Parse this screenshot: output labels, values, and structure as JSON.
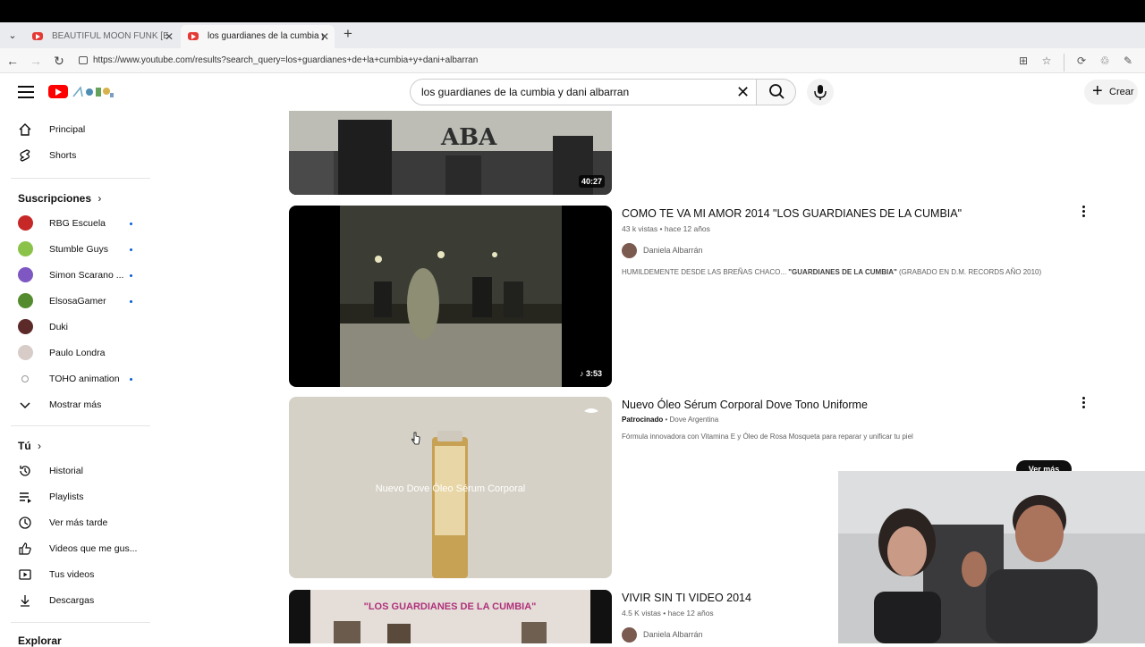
{
  "browser": {
    "tabs": [
      {
        "label": "BEAUTIFUL MOON FUNK [EXTENDED]",
        "active": false
      },
      {
        "label": "los guardianes de la cumbia y dani",
        "active": true
      }
    ],
    "url": "https://www.youtube.com/results?search_query=los+guardianes+de+la+cumbia+y+dani+albarran"
  },
  "header": {
    "search_value": "los guardianes de la cumbia y dani albarran",
    "create_label": "Crear"
  },
  "sidebar": {
    "main": [
      {
        "label": "Principal",
        "icon": "home-icon"
      },
      {
        "label": "Shorts",
        "icon": "shorts-icon"
      }
    ],
    "subscriptions_title": "Suscripciones",
    "subscriptions": [
      {
        "label": "RBG Escuela",
        "dot": true,
        "color": "#c62828"
      },
      {
        "label": "Stumble Guys",
        "dot": true,
        "color": "#8bc34a"
      },
      {
        "label": "Simon Scarano ...",
        "dot": true,
        "color": "#7e57c2"
      },
      {
        "label": "ElsosaGamer",
        "dot": true,
        "color": "#558b2f"
      },
      {
        "label": "Duki",
        "dot": false,
        "color": "#5d2a2a"
      },
      {
        "label": "Paulo Londra",
        "dot": false,
        "color": "#d7ccc8"
      },
      {
        "label": "TOHO animation",
        "dot": true,
        "color": "#ffffff"
      }
    ],
    "show_more": "Mostrar más",
    "you_title": "Tú",
    "you": [
      {
        "label": "Historial",
        "icon": "history-icon"
      },
      {
        "label": "Playlists",
        "icon": "playlist-icon"
      },
      {
        "label": "Ver más tarde",
        "icon": "clock-icon"
      },
      {
        "label": "Videos que me gus...",
        "icon": "thumbs-up-icon"
      },
      {
        "label": "Tus videos",
        "icon": "play-square-icon"
      },
      {
        "label": "Descargas",
        "icon": "download-icon"
      }
    ],
    "explore_title": "Explorar"
  },
  "results": [
    {
      "duration": "40:27"
    },
    {
      "title": "COMO TE VA MI AMOR 2014 \"LOS GUARDIANES DE LA CUMBIA\"",
      "views": "43 k vistas",
      "age": "hace 12 años",
      "channel": "Daniela Albarrán",
      "desc_pre": "HUMILDEMENTE DESDE LAS BREÑAS CHACO... ",
      "desc_bold": "\"GUARDIANES DE LA CUMBIA\"",
      "desc_post": " (GRABADO EN D.M. RECORDS AÑO 2010)",
      "duration": "3:53"
    },
    {
      "title": "Nuevo Óleo Sérum Corporal Dove Tono Uniforme",
      "sponsored": "Patrocinado",
      "advertiser": "Dove Argentina",
      "desc": "Fórmula innovadora con Vitamina E y Óleo de Rosa Mosqueta para reparar y unificar tu piel",
      "overlay_text": "Nuevo Dove Óleo Sérum Corporal",
      "cta": "Ver más"
    },
    {
      "title": "VIVIR SIN TI VIDEO 2014",
      "views": "4.5 K vistas",
      "age": "hace 12 años",
      "channel": "Daniela Albarrán",
      "banner_text": "\"LOS GUARDIANES DE LA CUMBIA\""
    }
  ]
}
